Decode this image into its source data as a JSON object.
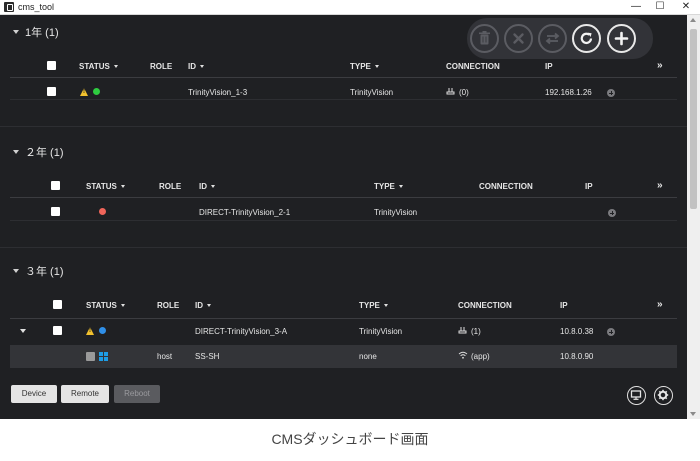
{
  "window": {
    "title": "cms_tool",
    "min_glyph": "—",
    "max_glyph": "☐",
    "close_glyph": "✕"
  },
  "toolbar": {
    "icons": [
      "trash-icon",
      "close-icon",
      "swap-icon",
      "refresh-icon",
      "plus-icon"
    ]
  },
  "columns": {
    "status": "STATUS",
    "role": "ROLE",
    "id": "ID",
    "type": "TYPE",
    "connection": "CONNECTION",
    "ip": "IP",
    "more": "»"
  },
  "groups": [
    {
      "title": "1年 (1)",
      "rows": [
        {
          "status_icons": [
            "warning-icon",
            "status-dot-green"
          ],
          "role": "",
          "id": "TrinityVision_1-3",
          "type": "TrinityVision",
          "connection": "(0)",
          "ip": "192.168.1.26"
        }
      ]
    },
    {
      "title": "２年 (1)",
      "rows": [
        {
          "status_icons": [
            "status-dot-red"
          ],
          "role": "",
          "id": "DIRECT-TrinityVision_2-1",
          "type": "TrinityVision",
          "connection": "",
          "ip": ""
        }
      ]
    },
    {
      "title": "３年 (1)",
      "rows": [
        {
          "status_icons": [
            "warning-icon",
            "status-dot-blue"
          ],
          "role": "",
          "id": "DIRECT-TrinityVision_3-A",
          "type": "TrinityVision",
          "connection": "(1)",
          "ip": "10.8.0.38",
          "expanded": true,
          "children": [
            {
              "status_icons": [
                "windows-icon"
              ],
              "role": "host",
              "id": "SS-SH",
              "type": "none",
              "connection": "(app)",
              "ip": "10.8.0.90"
            }
          ]
        }
      ]
    }
  ],
  "colors": {
    "green": "#2ecc40",
    "red": "#f0655a",
    "blue": "#2f8fe8",
    "warning": "#f2c12e",
    "windows": "#1e9de6"
  },
  "bottom_bar": {
    "device_label": "Device",
    "remote_label": "Remote",
    "reboot_label": "Reboot",
    "icons": [
      "monitor-icon",
      "gear-icon"
    ]
  },
  "caption": "CMSダッシュボード画面"
}
